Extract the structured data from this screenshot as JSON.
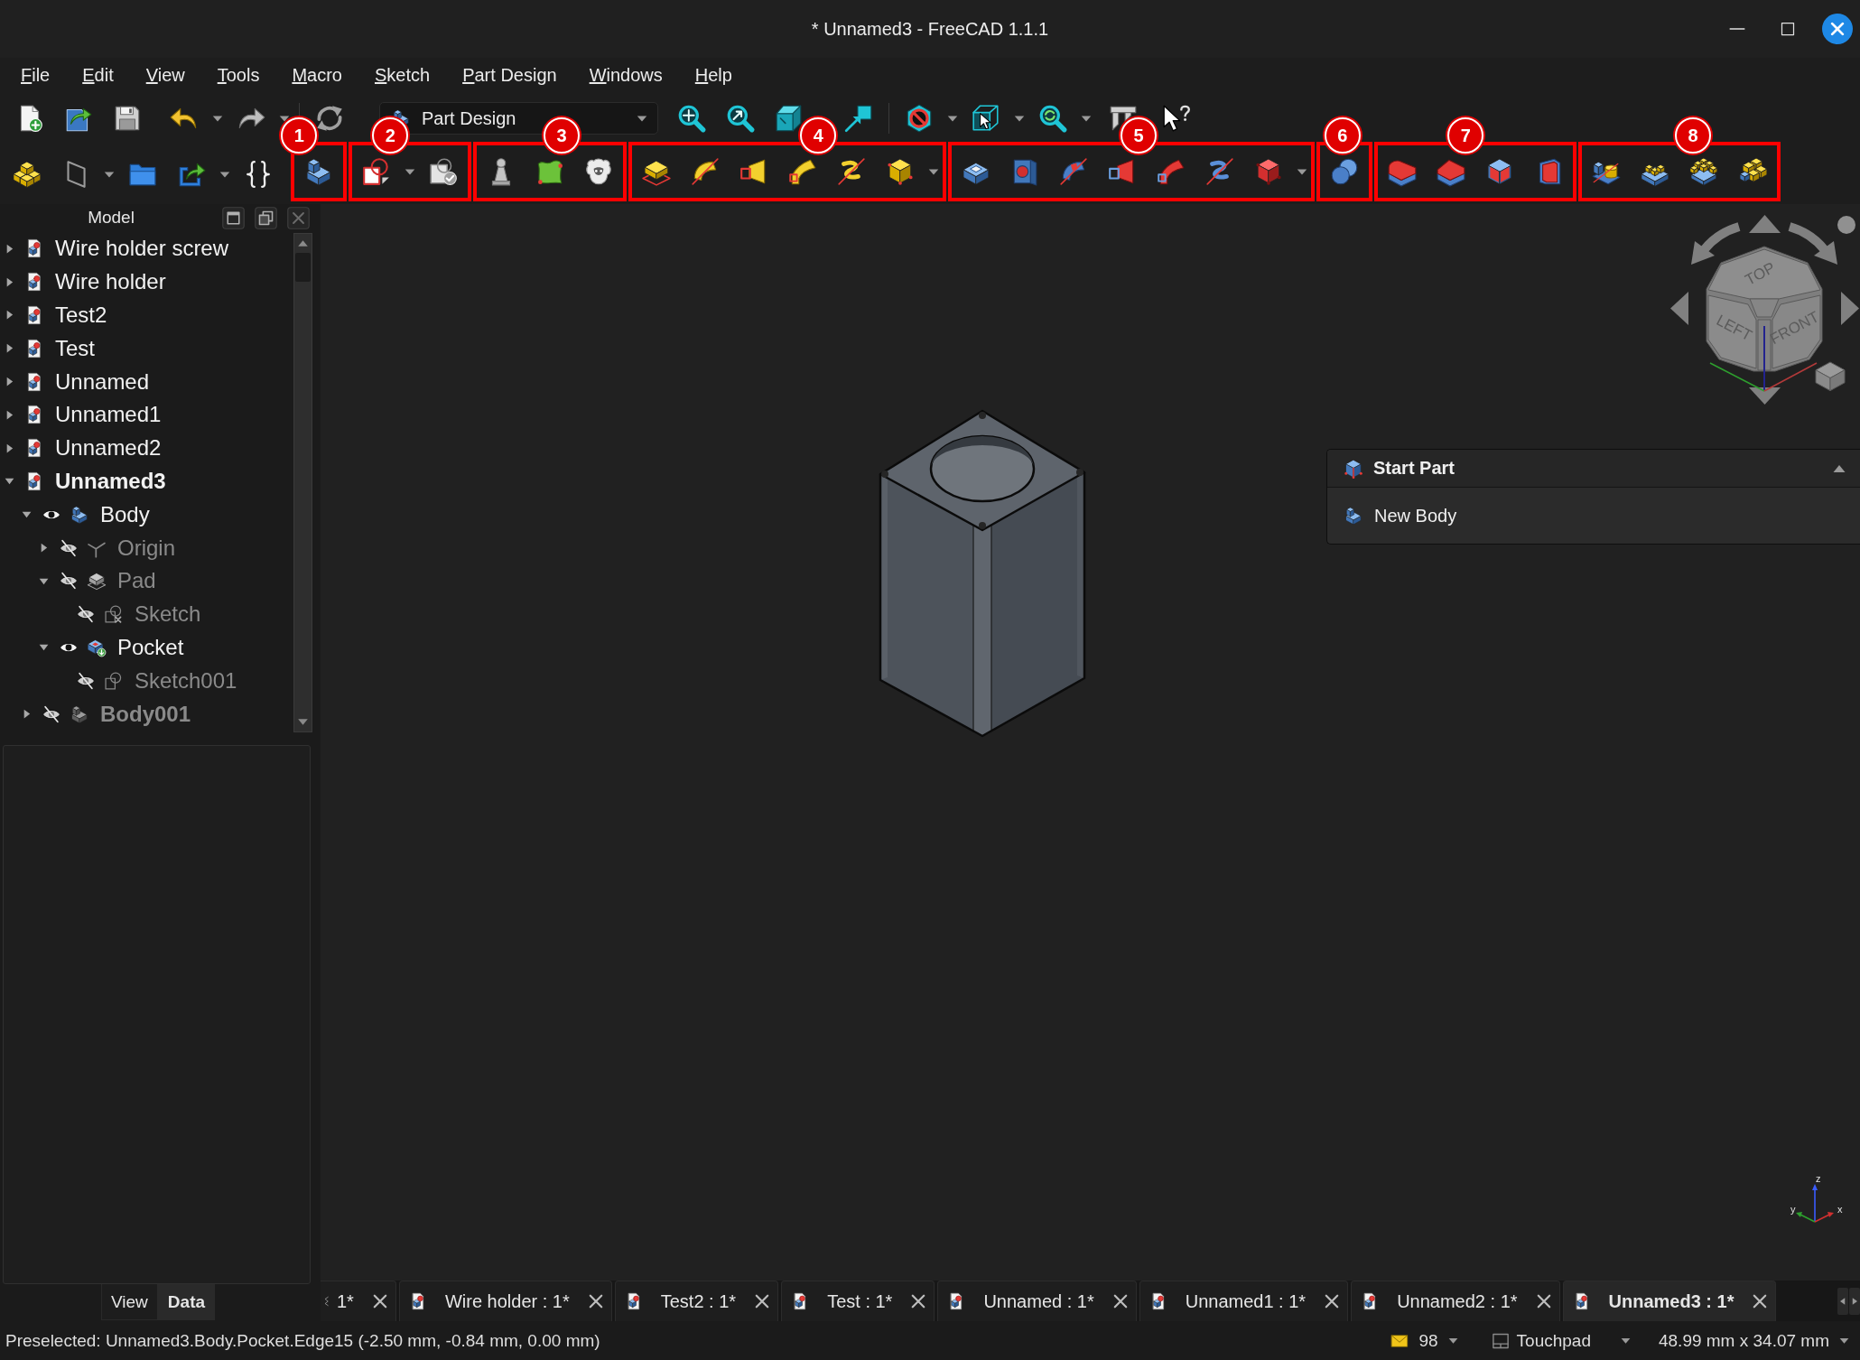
{
  "window": {
    "title": "* Unnamed3 - FreeCAD 1.1.1"
  },
  "menu_bar": [
    "File",
    "Edit",
    "View",
    "Tools",
    "Macro",
    "Sketch",
    "Part Design",
    "Windows",
    "Help"
  ],
  "toolbar": {
    "workbench": "Part Design"
  },
  "annotations": [
    {
      "label": "1"
    },
    {
      "label": "2"
    },
    {
      "label": "3"
    },
    {
      "label": "4"
    },
    {
      "label": "5"
    },
    {
      "label": "6"
    },
    {
      "label": "7"
    },
    {
      "label": "8"
    }
  ],
  "model_panel": {
    "title": "Model",
    "tree": [
      {
        "label": "Wire holder screw",
        "kind": "document",
        "expanded": false,
        "active": false
      },
      {
        "label": "Wire holder",
        "kind": "document",
        "expanded": false,
        "active": false
      },
      {
        "label": "Test2",
        "kind": "document",
        "expanded": false,
        "active": false
      },
      {
        "label": "Test",
        "kind": "document",
        "expanded": false,
        "active": false
      },
      {
        "label": "Unnamed",
        "kind": "document",
        "expanded": false,
        "active": false
      },
      {
        "label": "Unnamed1",
        "kind": "document",
        "expanded": false,
        "active": false
      },
      {
        "label": "Unnamed2",
        "kind": "document",
        "expanded": false,
        "active": false
      },
      {
        "label": "Unnamed3",
        "kind": "document",
        "expanded": true,
        "active": true,
        "children": [
          {
            "label": "Body",
            "kind": "body",
            "expanded": true,
            "visible": true,
            "active": false,
            "children": [
              {
                "label": "Origin",
                "kind": "origin",
                "expanded": false,
                "visible": false,
                "active": false
              },
              {
                "label": "Pad",
                "kind": "pad",
                "expanded": true,
                "visible": false,
                "active": false,
                "children": [
                  {
                    "label": "Sketch",
                    "kind": "sketch",
                    "visible": false,
                    "active": false,
                    "warning": true
                  }
                ]
              },
              {
                "label": "Pocket",
                "kind": "pocket",
                "expanded": true,
                "visible": true,
                "active": false,
                "children": [
                  {
                    "label": "Sketch001",
                    "kind": "sketch",
                    "visible": false,
                    "active": false,
                    "warning": false
                  }
                ]
              }
            ]
          },
          {
            "label": "Body001",
            "kind": "body",
            "expanded": false,
            "visible": false,
            "active": true
          }
        ]
      }
    ]
  },
  "property_panel": {
    "tabs": [
      {
        "label": "View",
        "selected": false
      },
      {
        "label": "Data",
        "selected": true
      }
    ]
  },
  "navigation_cube": {
    "faces": [
      "TOP",
      "LEFT",
      "FRONT"
    ]
  },
  "task_panel": {
    "title": "Start Part",
    "expanded": true,
    "actions": [
      "New Body"
    ]
  },
  "axis_triad": {
    "labels": [
      "z",
      "y",
      "x"
    ]
  },
  "document_tabs": [
    {
      "label": "1*",
      "selected": false,
      "clipped": true
    },
    {
      "label": "Wire holder : 1*",
      "selected": false,
      "clipped": false
    },
    {
      "label": "Test2 : 1*",
      "selected": false,
      "clipped": false
    },
    {
      "label": "Test : 1*",
      "selected": false,
      "clipped": false
    },
    {
      "label": "Unnamed : 1*",
      "selected": false,
      "clipped": false
    },
    {
      "label": "Unnamed1 : 1*",
      "selected": false,
      "clipped": false
    },
    {
      "label": "Unnamed2 : 1*",
      "selected": false,
      "clipped": false
    },
    {
      "label": "Unnamed3 : 1*",
      "selected": true,
      "clipped": false
    }
  ],
  "status_bar": {
    "message": "Preselected: Unnamed3.Body.Pocket.Edge15 (-2.50 mm, -0.84 mm, 0.00 mm)",
    "notifications": "98",
    "navigation_style": "Touchpad",
    "dimensions": "48.99 mm x 34.07 mm"
  }
}
